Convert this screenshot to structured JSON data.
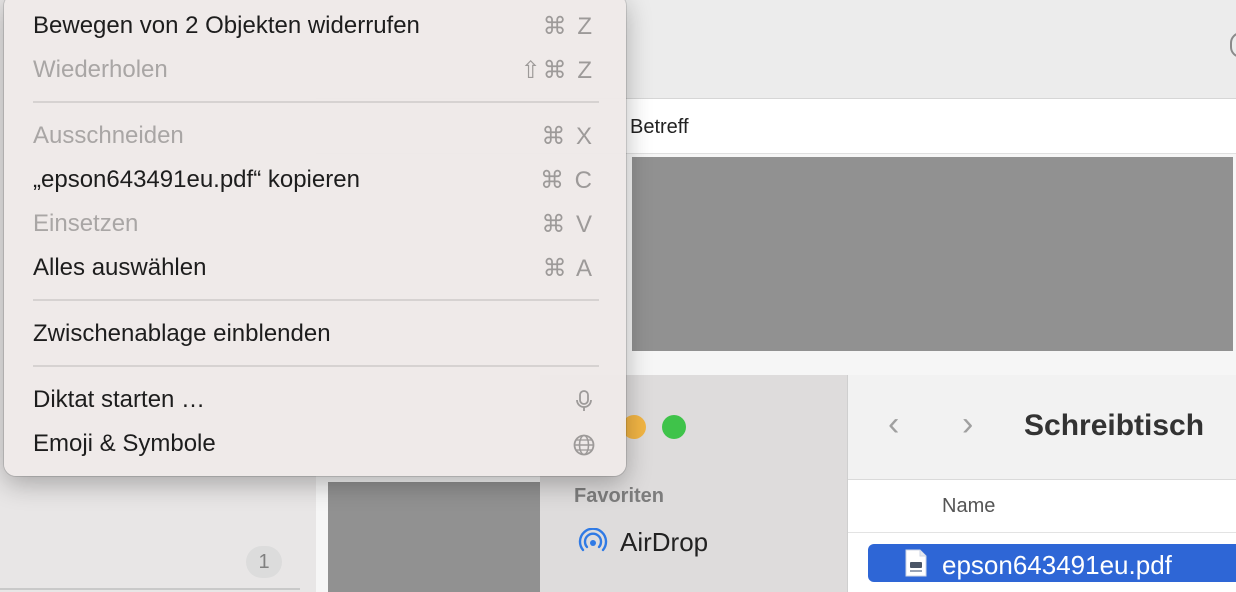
{
  "menu": {
    "items": [
      {
        "label": "Bewegen von 2 Objekten widerrufen",
        "shortcut": "⌘ Z",
        "enabled": true
      },
      {
        "label": "Wiederholen",
        "shortcut": "⇧⌘ Z",
        "enabled": false
      },
      {
        "label": "Ausschneiden",
        "shortcut": "⌘ X",
        "enabled": false
      },
      {
        "label": "„epson643491eu.pdf“ kopieren",
        "shortcut": "⌘ C",
        "enabled": true
      },
      {
        "label": "Einsetzen",
        "shortcut": "⌘ V",
        "enabled": false
      },
      {
        "label": "Alles auswählen",
        "shortcut": "⌘ A",
        "enabled": true
      },
      {
        "label": "Zwischenablage einblenden",
        "enabled": true
      },
      {
        "label": "Diktat starten …",
        "icon": "microphone-icon",
        "enabled": true
      },
      {
        "label": "Emoji & Symbole",
        "icon": "globe-icon",
        "enabled": true
      }
    ]
  },
  "mail": {
    "subject_column": "Betreff",
    "unread_count": "1"
  },
  "finder": {
    "title": "Schreibtisch",
    "sidebar_heading": "Favoriten",
    "sidebar_items": [
      {
        "label": "AirDrop",
        "icon": "airdrop-icon"
      }
    ],
    "column_name": "Name",
    "selected_file": "epson643491eu.pdf",
    "nav_back": "‹",
    "nav_forward": "›"
  },
  "colors": {
    "selection": "#2e66d6",
    "redaction": "#919191"
  }
}
